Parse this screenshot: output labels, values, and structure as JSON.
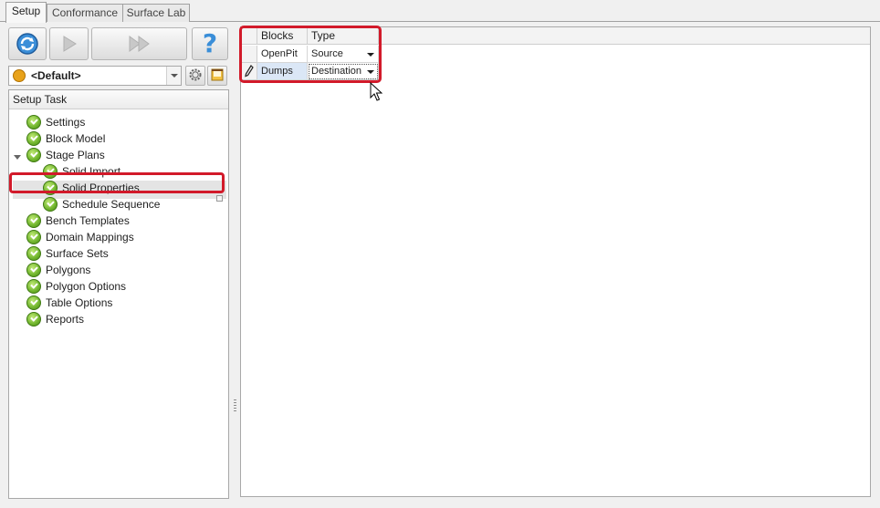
{
  "tabs": [
    "Setup",
    "Conformance",
    "Surface Lab"
  ],
  "active_tab": "Setup",
  "toolbar": {
    "refresh_icon": "refresh-icon",
    "run_icon": "play-icon",
    "run_all_icon": "fast-forward-icon",
    "help_icon": "question-mark-icon",
    "help_glyph": "?"
  },
  "profile": {
    "value": "<Default>",
    "icon": "theatre-mask-icon"
  },
  "tree": {
    "header": "Setup Task",
    "items": [
      "Settings",
      "Block Model",
      "Stage Plans",
      "Solid Import",
      "Solid Properties",
      "Schedule Sequence",
      "Bench Templates",
      "Domain Mappings",
      "Surface Sets",
      "Polygons",
      "Polygon Options",
      "Table Options",
      "Reports"
    ],
    "selected": "Solid Properties",
    "status_icon": "check-circle-icon",
    "colors": {
      "selected_row": "#e4e4e4",
      "check_green": "#6fb42c"
    }
  },
  "grid": {
    "columns": [
      "Blocks",
      "Type"
    ],
    "rows": [
      {
        "block": "OpenPit",
        "type": "Source"
      },
      {
        "block": "Dumps",
        "type": "Destination"
      }
    ],
    "editing_row": "Dumps",
    "edit_indicator_icon": "pencil-icon"
  },
  "highlight_color": "#d21a2a"
}
